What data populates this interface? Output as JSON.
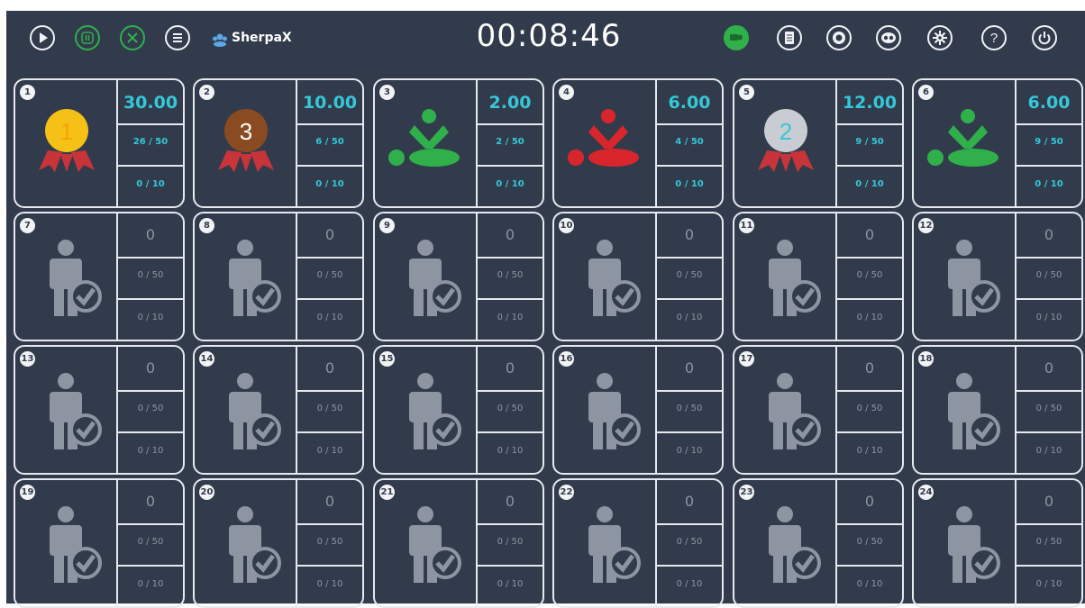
{
  "toolbar": {
    "brand": "SherpaX",
    "timer": "00:08:46",
    "left_icons": [
      "play-icon",
      "pause-icon",
      "stop-icon",
      "menu-icon"
    ],
    "right_icons": [
      "connect-icon",
      "report-icon",
      "record-icon",
      "compare-icon",
      "settings-icon",
      "help-icon",
      "power-icon"
    ]
  },
  "colors": {
    "background": "#323b4c",
    "accent": "#35c8d8",
    "active_green": "#2fb04a",
    "alert_red": "#d9262c",
    "inactive": "#8d94a2",
    "gold": "#f5c116",
    "bronze": "#8a4b23",
    "silver": "#c9ccd2"
  },
  "stations": [
    {
      "number": "1",
      "score": "30.00",
      "compressions": "26 / 50",
      "ventilations": "0 / 10",
      "status": "rank-1",
      "rank": "1"
    },
    {
      "number": "2",
      "score": "10.00",
      "compressions": "6 / 50",
      "ventilations": "0 / 10",
      "status": "rank-3",
      "rank": "3"
    },
    {
      "number": "3",
      "score": "2.00",
      "compressions": "2 / 50",
      "ventilations": "0 / 10",
      "status": "cpr-green"
    },
    {
      "number": "4",
      "score": "6.00",
      "compressions": "4 / 50",
      "ventilations": "0 / 10",
      "status": "cpr-red"
    },
    {
      "number": "5",
      "score": "12.00",
      "compressions": "9 / 50",
      "ventilations": "0 / 10",
      "status": "rank-2",
      "rank": "2"
    },
    {
      "number": "6",
      "score": "6.00",
      "compressions": "9 / 50",
      "ventilations": "0 / 10",
      "status": "cpr-green"
    },
    {
      "number": "7",
      "score": "0",
      "compressions": "0 / 50",
      "ventilations": "0 / 10",
      "status": "idle"
    },
    {
      "number": "8",
      "score": "0",
      "compressions": "0 / 50",
      "ventilations": "0 / 10",
      "status": "idle"
    },
    {
      "number": "9",
      "score": "0",
      "compressions": "0 / 50",
      "ventilations": "0 / 10",
      "status": "idle"
    },
    {
      "number": "10",
      "score": "0",
      "compressions": "0 / 50",
      "ventilations": "0 / 10",
      "status": "idle"
    },
    {
      "number": "11",
      "score": "0",
      "compressions": "0 / 50",
      "ventilations": "0 / 10",
      "status": "idle"
    },
    {
      "number": "12",
      "score": "0",
      "compressions": "0 / 50",
      "ventilations": "0 / 10",
      "status": "idle"
    },
    {
      "number": "13",
      "score": "0",
      "compressions": "0 / 50",
      "ventilations": "0 / 10",
      "status": "idle"
    },
    {
      "number": "14",
      "score": "0",
      "compressions": "0 / 50",
      "ventilations": "0 / 10",
      "status": "idle"
    },
    {
      "number": "15",
      "score": "0",
      "compressions": "0 / 50",
      "ventilations": "0 / 10",
      "status": "idle"
    },
    {
      "number": "16",
      "score": "0",
      "compressions": "0 / 50",
      "ventilations": "0 / 10",
      "status": "idle"
    },
    {
      "number": "17",
      "score": "0",
      "compressions": "0 / 50",
      "ventilations": "0 / 10",
      "status": "idle"
    },
    {
      "number": "18",
      "score": "0",
      "compressions": "0 / 50",
      "ventilations": "0 / 10",
      "status": "idle"
    },
    {
      "number": "19",
      "score": "0",
      "compressions": "0 / 50",
      "ventilations": "0 / 10",
      "status": "idle"
    },
    {
      "number": "20",
      "score": "0",
      "compressions": "0 / 50",
      "ventilations": "0 / 10",
      "status": "idle"
    },
    {
      "number": "21",
      "score": "0",
      "compressions": "0 / 50",
      "ventilations": "0 / 10",
      "status": "idle"
    },
    {
      "number": "22",
      "score": "0",
      "compressions": "0 / 50",
      "ventilations": "0 / 10",
      "status": "idle"
    },
    {
      "number": "23",
      "score": "0",
      "compressions": "0 / 50",
      "ventilations": "0 / 10",
      "status": "idle"
    },
    {
      "number": "24",
      "score": "0",
      "compressions": "0 / 50",
      "ventilations": "0 / 10",
      "status": "idle"
    }
  ]
}
